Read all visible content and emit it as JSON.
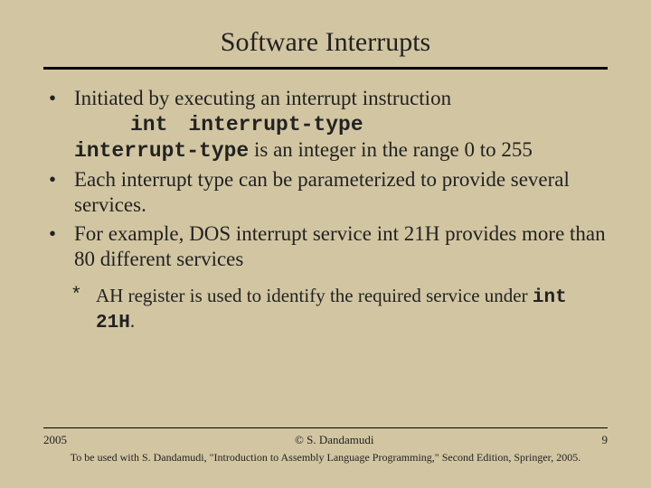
{
  "title": "Software Interrupts",
  "bullets": {
    "b1_intro": "Initiated by executing an interrupt instruction",
    "b1_syntax_kw": "int",
    "b1_syntax_arg": "interrupt-type",
    "b1_range_pre": "interrupt-type",
    "b1_range_post": " is an integer in the range 0 to 255",
    "b2": "Each interrupt type can be parameterized to provide several services.",
    "b3": "For example, DOS interrupt service int  21H provides more than 80 different services"
  },
  "sub": {
    "text_pre": "AH register is used to identify the required service under ",
    "code": "int  21H",
    "text_post": "."
  },
  "footer": {
    "year": "2005",
    "copyright": "© S. Dandamudi",
    "page": "9",
    "citation": "To be used with S. Dandamudi, \"Introduction to Assembly Language Programming,\" Second Edition, Springer, 2005."
  }
}
